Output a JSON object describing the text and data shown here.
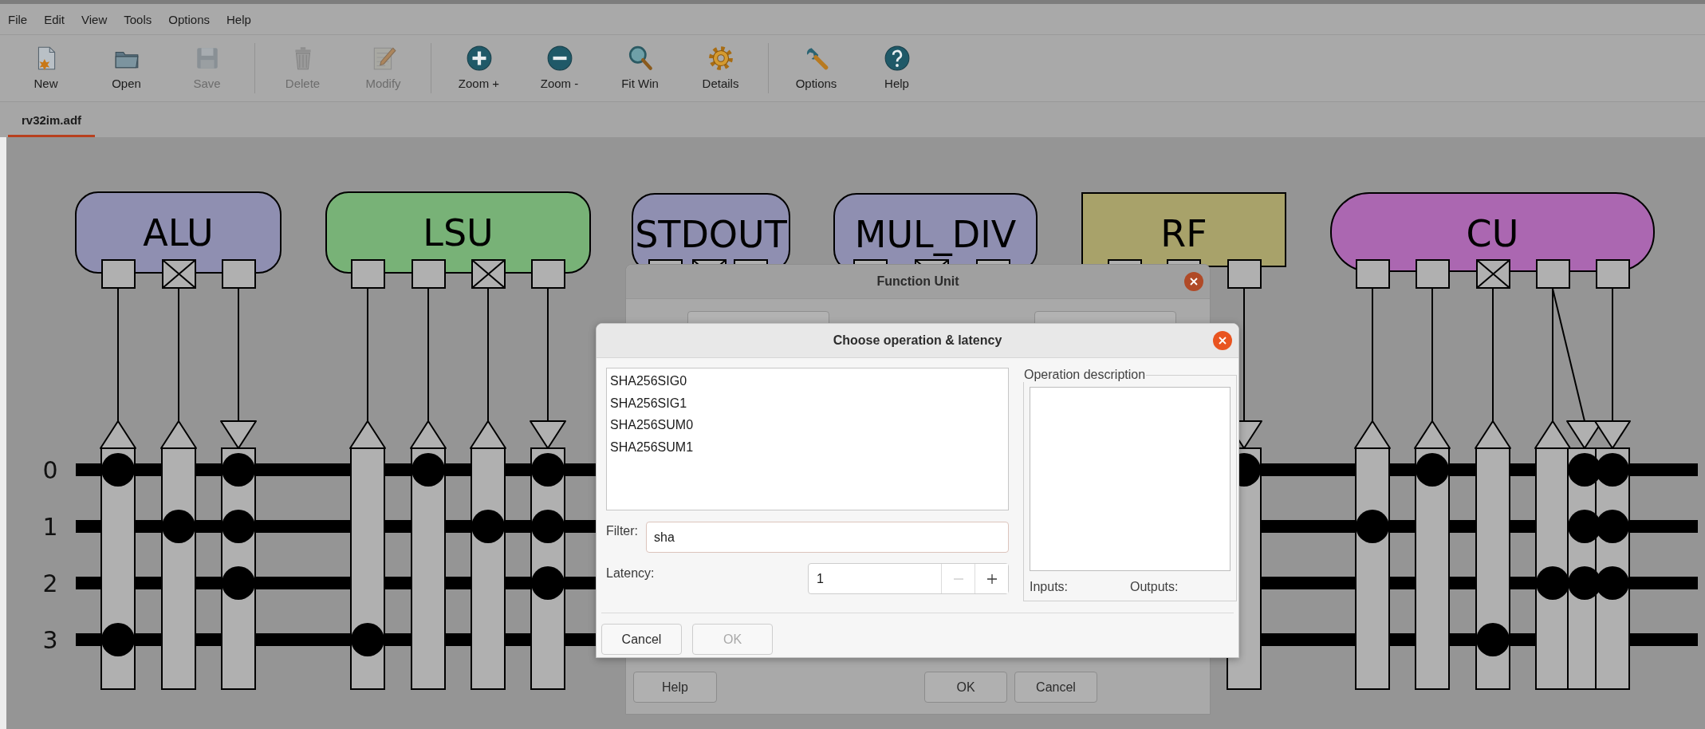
{
  "menu": [
    {
      "label": "File"
    },
    {
      "label": "Edit"
    },
    {
      "label": "View"
    },
    {
      "label": "Tools"
    },
    {
      "label": "Options"
    },
    {
      "label": "Help"
    }
  ],
  "toolbar": [
    {
      "items": [
        {
          "label": "New",
          "disabled": false
        },
        {
          "label": "Open",
          "disabled": false
        },
        {
          "label": "Save",
          "disabled": true
        }
      ]
    },
    {
      "items": [
        {
          "label": "Delete",
          "disabled": true
        },
        {
          "label": "Modify",
          "disabled": true
        }
      ]
    },
    {
      "items": [
        {
          "label": "Zoom +",
          "disabled": false
        },
        {
          "label": "Zoom -",
          "disabled": false
        },
        {
          "label": "Fit Win",
          "disabled": false
        },
        {
          "label": "Details",
          "disabled": false
        }
      ]
    },
    {
      "items": [
        {
          "label": "Options",
          "disabled": false
        },
        {
          "label": "Help",
          "disabled": false
        }
      ]
    }
  ],
  "tabs": [
    {
      "label": "rv32im.adf",
      "selected": true
    }
  ],
  "canvas": {
    "units": [
      {
        "name": "ALU",
        "kind": "function_unit",
        "color": "#8f8fb1",
        "ports": [
          {
            "kind": "plain"
          },
          {
            "kind": "crossed"
          },
          {
            "kind": "plain"
          }
        ]
      },
      {
        "name": "LSU",
        "kind": "function_unit",
        "color": "#78b277",
        "ports": [
          {
            "kind": "plain"
          },
          {
            "kind": "plain"
          },
          {
            "kind": "crossed"
          },
          {
            "kind": "plain"
          }
        ]
      },
      {
        "name": "STDOUT",
        "kind": "function_unit",
        "color": "#8f8fb1",
        "ports": [
          {
            "kind": "plain"
          },
          {
            "kind": "crossed"
          },
          {
            "kind": "plain"
          }
        ]
      },
      {
        "name": "MUL_DIV",
        "kind": "function_unit",
        "color": "#8f8fb1",
        "ports": [
          {
            "kind": "plain"
          },
          {
            "kind": "crossed"
          },
          {
            "kind": "plain"
          }
        ]
      },
      {
        "name": "RF",
        "kind": "register_file",
        "color": "#a8a26a",
        "ports": [
          {
            "kind": "plain"
          },
          {
            "kind": "plain"
          },
          {
            "kind": "plain"
          }
        ]
      },
      {
        "name": "CU",
        "kind": "control_unit",
        "color": "#ab67b1",
        "ports": [
          {
            "kind": "plain"
          },
          {
            "kind": "plain"
          },
          {
            "kind": "crossed"
          },
          {
            "kind": "plain"
          },
          {
            "kind": "plain"
          }
        ]
      }
    ],
    "buses": [
      {
        "label": "0"
      },
      {
        "label": "1"
      },
      {
        "label": "2"
      },
      {
        "label": "3"
      }
    ],
    "sockets": [
      {
        "kind": "input",
        "dots": [
          true,
          false,
          false,
          true
        ]
      },
      {
        "kind": "input",
        "dots": [
          false,
          true,
          false,
          false
        ]
      },
      {
        "kind": "output",
        "dots": [
          true,
          true,
          true,
          false
        ]
      },
      {
        "kind": "input",
        "dots": [
          false,
          false,
          false,
          true
        ]
      },
      {
        "kind": "input",
        "dots": [
          true,
          false,
          false,
          false
        ]
      },
      {
        "kind": "input",
        "dots": [
          false,
          true,
          false,
          false
        ]
      },
      {
        "kind": "output",
        "dots": [
          true,
          true,
          true,
          false
        ]
      },
      {
        "kind": "output",
        "dots": [
          true,
          false,
          false,
          false
        ]
      },
      {
        "kind": "input",
        "dots": [
          false,
          true,
          false,
          false
        ]
      },
      {
        "kind": "input",
        "dots": [
          true,
          false,
          false,
          false
        ]
      },
      {
        "kind": "input",
        "dots": [
          false,
          false,
          false,
          true
        ]
      },
      {
        "kind": "input",
        "dots": [
          false,
          false,
          true,
          false
        ]
      },
      {
        "kind": "output",
        "dots": [
          true,
          true,
          true,
          false
        ]
      },
      {
        "kind": "output",
        "dots": [
          true,
          true,
          true,
          false
        ]
      }
    ]
  },
  "function_unit_dialog": {
    "title": "Function Unit",
    "buttons_left": [
      {
        "label": "Help"
      }
    ],
    "buttons_right": [
      {
        "label": "OK"
      },
      {
        "label": "Cancel"
      }
    ]
  },
  "operation_dialog": {
    "title": "Choose operation & latency",
    "operations": [
      {
        "label": "SHA256SIG0",
        "selected": false
      },
      {
        "label": "SHA256SIG1",
        "selected": false
      },
      {
        "label": "SHA256SUM0",
        "selected": false
      },
      {
        "label": "SHA256SUM1",
        "selected": false
      }
    ],
    "filter": {
      "label": "Filter:",
      "value": "sha"
    },
    "latency": {
      "label": "Latency:",
      "value": "1",
      "decrement_disabled": true,
      "increment_disabled": false
    },
    "description": {
      "title": "Operation description",
      "inputs_label": "Inputs:",
      "outputs_label": "Outputs:"
    },
    "buttons": [
      {
        "label": "Cancel",
        "disabled": false
      },
      {
        "label": "OK",
        "disabled": true
      }
    ]
  }
}
